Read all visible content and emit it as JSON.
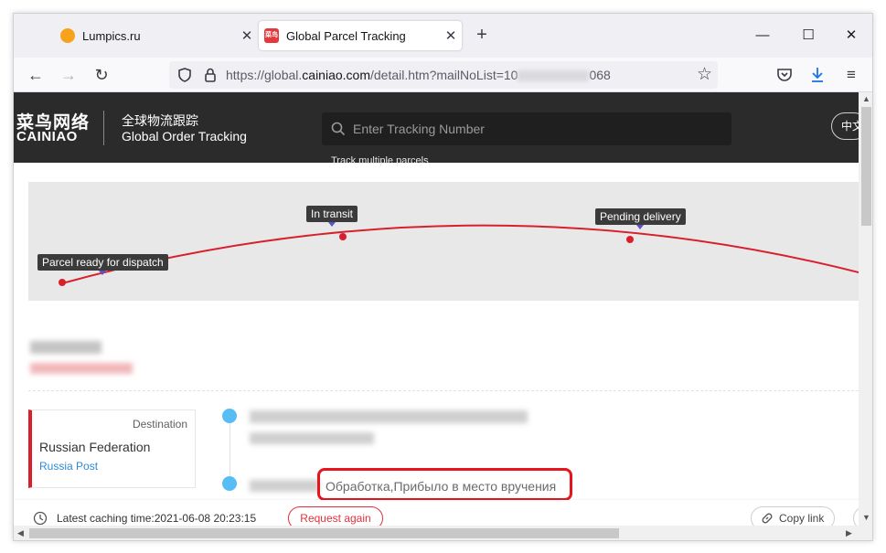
{
  "browser": {
    "tabs": [
      {
        "title": "Lumpics.ru",
        "icon": "lumpics-favicon"
      },
      {
        "title": "Global Parcel Tracking",
        "icon": "cainiao-favicon",
        "active": true
      }
    ],
    "url": {
      "prefix": "https://global.",
      "host": "cainiao.com",
      "path": "/detail.htm?mailNoList=10",
      "suffix": "068"
    }
  },
  "site": {
    "logo_cn": "菜鸟网络",
    "logo_en": "CAINIAO",
    "subtitle_cn": "全球物流跟踪",
    "subtitle_en": "Global Order Tracking",
    "search_placeholder": "Enter Tracking Number",
    "multi_link": "Track multiple parcels",
    "lang_button": "中文"
  },
  "map": {
    "stages": [
      {
        "label": "Parcel ready for dispatch"
      },
      {
        "label": "In transit"
      },
      {
        "label": "Pending delivery"
      }
    ],
    "route_color": "#d8202c"
  },
  "destination": {
    "label": "Destination",
    "country": "Russian Federation",
    "carrier": "Russia Post"
  },
  "events": [
    {
      "text": "Обработка,Прибыло в место вручения",
      "highlighted": true
    }
  ],
  "footer": {
    "cache_text": "Latest caching time:2021-06-08 20:23:15",
    "request_button": "Request again",
    "copy_button": "Copy link"
  },
  "colors": {
    "accent_red": "#e3303b",
    "timeline_dot": "#58bdf5",
    "header_bg": "#2b2b2b"
  }
}
